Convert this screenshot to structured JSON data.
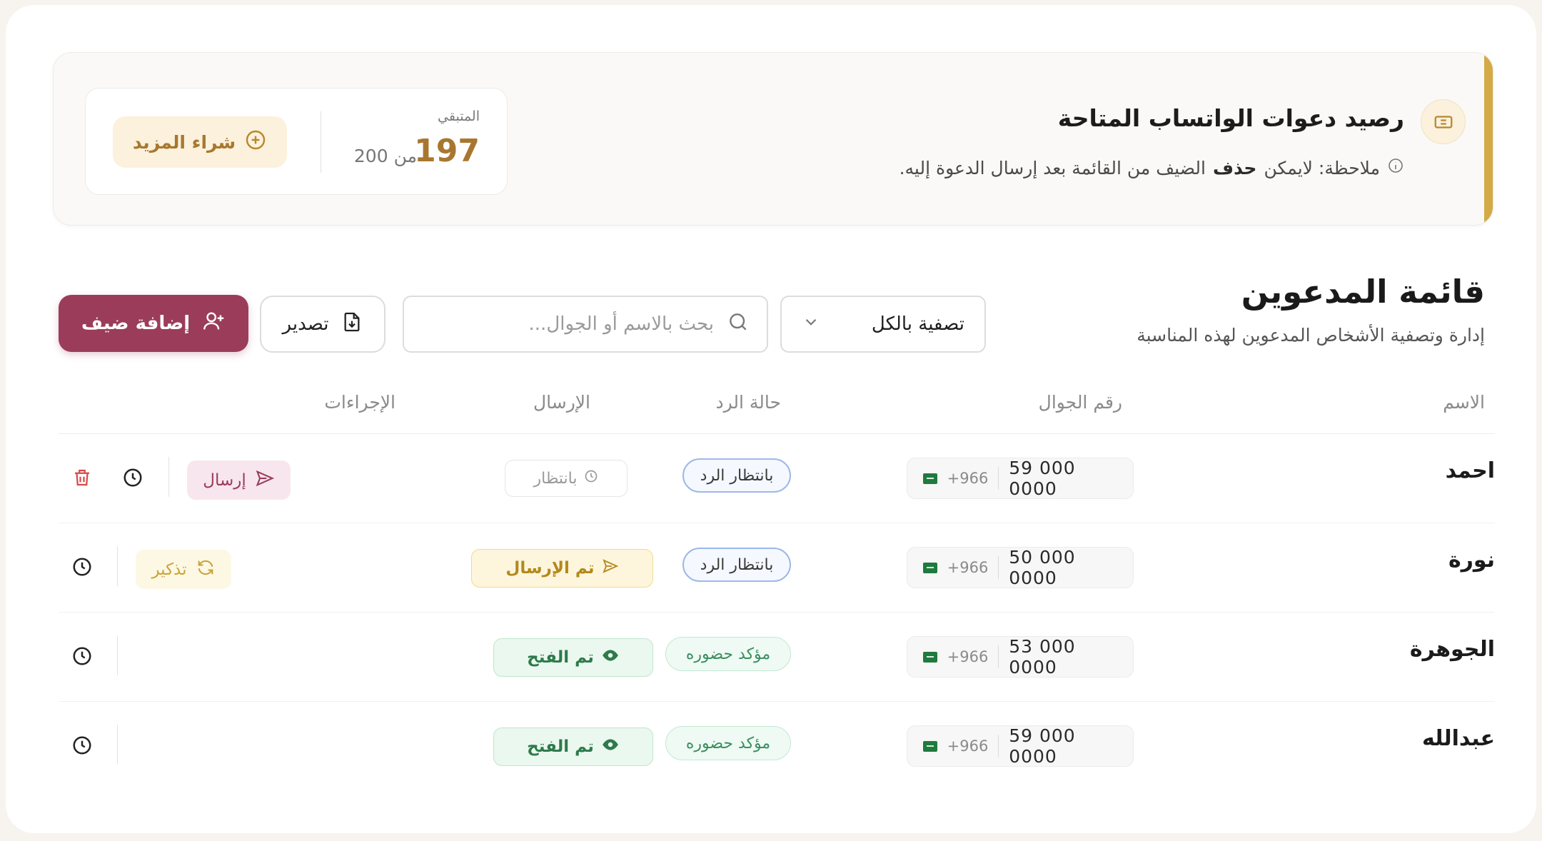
{
  "banner": {
    "title": "رصيد دعوات الواتساب المتاحة",
    "note_prefix": "ملاحظة: لايمكن",
    "note_bold": "حذف",
    "note_suffix": "الضيف من القائمة بعد إرسال الدعوة إليه.",
    "remaining_label": "المتبقي",
    "remaining_value": "197",
    "total_text": "من 200",
    "remaining": 197,
    "total": 200,
    "buy_button": "شراء المزيد",
    "accent_color": "#d4aa46"
  },
  "list": {
    "title": "قائمة المدعوين",
    "subtitle": "إدارة وتصفية الأشخاص المدعوين لهذه المناسبة",
    "filter_value": "تصفية بالكل",
    "search_placeholder": "بحث بالاسم أو الجوال...",
    "export_label": "تصدير",
    "add_guest_label": "إضافة ضيف",
    "brand_color": "#9b3d5a"
  },
  "table": {
    "headers": {
      "name": "الاسم",
      "phone": "رقم الجوال",
      "reply": "حالة الرد",
      "sending": "الإرسال",
      "actions": "الإجراءات"
    },
    "rows": [
      {
        "name": "احمد",
        "country_code": "+966",
        "phone": "59 000 0000",
        "reply": "بانتظار الرد",
        "sending": "بانتظار",
        "action": "إرسال"
      },
      {
        "name": "نورة",
        "country_code": "+966",
        "phone": "50 000 0000",
        "reply": "بانتظار الرد",
        "sending": "تم الإرسال",
        "action": "تذكير"
      },
      {
        "name": "الجوهرة",
        "country_code": "+966",
        "phone": "53 000 0000",
        "reply": "مؤكد حضوره",
        "sending": "تم الفتح"
      },
      {
        "name": "عبدالله",
        "country_code": "+966",
        "phone": "59 000 0000",
        "reply": "مؤكد حضوره",
        "sending": "تم الفتح"
      }
    ]
  },
  "icons": {
    "banner": "ticket-icon",
    "note": "info-icon",
    "buy": "plus-circle-icon",
    "filter": "chevron-down-icon",
    "search": "search-icon",
    "export": "file-download-icon",
    "add": "user-plus-icon",
    "flag": "saudi-flag-icon",
    "history": "clock-icon",
    "delete": "trash-icon",
    "send": "send-icon",
    "remind": "refresh-icon",
    "opened": "eye-icon"
  }
}
